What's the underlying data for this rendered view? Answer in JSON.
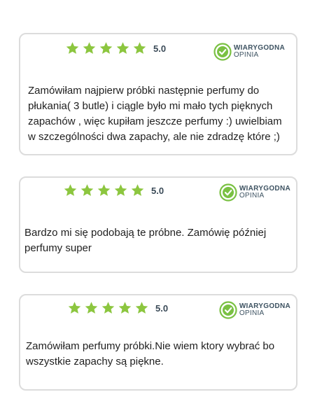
{
  "colors": {
    "star": "#8cc63f",
    "badge_green": "#7ac143",
    "badge_text": "#3d5261",
    "border": "#dcdcdc",
    "text": "#1f1f1f"
  },
  "badge": {
    "line1": "WIARYGODNA",
    "line2": "OPINIA",
    "icon": "check-circle-icon"
  },
  "reviews": [
    {
      "stars": 5,
      "score": "5.0",
      "text": "Zamówiłam najpierw próbki następnie perfumy do płukania( 3 butle) i ciągle było mi mało tych pięknych zapachów , więc kupiłam jeszcze perfumy :) uwielbiam w szczególności dwa zapachy, ale nie zdradzę które ;)"
    },
    {
      "stars": 5,
      "score": "5.0",
      "text": "Bardzo mi się podobają te próbne. Zamówię później perfumy super"
    },
    {
      "stars": 5,
      "score": "5.0",
      "text": "Zamówiłam perfumy próbki.Nie wiem ktory wybrać bo wszystkie zapachy są piękne."
    }
  ]
}
